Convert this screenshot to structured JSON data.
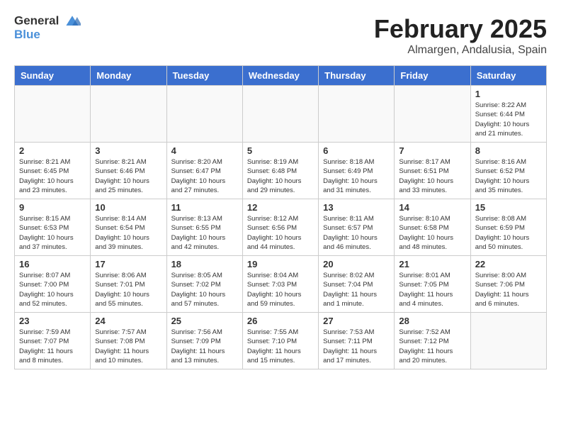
{
  "header": {
    "logo_line1": "General",
    "logo_line2": "Blue",
    "title": "February 2025",
    "subtitle": "Almargen, Andalusia, Spain"
  },
  "weekdays": [
    "Sunday",
    "Monday",
    "Tuesday",
    "Wednesday",
    "Thursday",
    "Friday",
    "Saturday"
  ],
  "weeks": [
    [
      {
        "day": "",
        "info": ""
      },
      {
        "day": "",
        "info": ""
      },
      {
        "day": "",
        "info": ""
      },
      {
        "day": "",
        "info": ""
      },
      {
        "day": "",
        "info": ""
      },
      {
        "day": "",
        "info": ""
      },
      {
        "day": "1",
        "info": "Sunrise: 8:22 AM\nSunset: 6:44 PM\nDaylight: 10 hours and 21 minutes."
      }
    ],
    [
      {
        "day": "2",
        "info": "Sunrise: 8:21 AM\nSunset: 6:45 PM\nDaylight: 10 hours and 23 minutes."
      },
      {
        "day": "3",
        "info": "Sunrise: 8:21 AM\nSunset: 6:46 PM\nDaylight: 10 hours and 25 minutes."
      },
      {
        "day": "4",
        "info": "Sunrise: 8:20 AM\nSunset: 6:47 PM\nDaylight: 10 hours and 27 minutes."
      },
      {
        "day": "5",
        "info": "Sunrise: 8:19 AM\nSunset: 6:48 PM\nDaylight: 10 hours and 29 minutes."
      },
      {
        "day": "6",
        "info": "Sunrise: 8:18 AM\nSunset: 6:49 PM\nDaylight: 10 hours and 31 minutes."
      },
      {
        "day": "7",
        "info": "Sunrise: 8:17 AM\nSunset: 6:51 PM\nDaylight: 10 hours and 33 minutes."
      },
      {
        "day": "8",
        "info": "Sunrise: 8:16 AM\nSunset: 6:52 PM\nDaylight: 10 hours and 35 minutes."
      }
    ],
    [
      {
        "day": "9",
        "info": "Sunrise: 8:15 AM\nSunset: 6:53 PM\nDaylight: 10 hours and 37 minutes."
      },
      {
        "day": "10",
        "info": "Sunrise: 8:14 AM\nSunset: 6:54 PM\nDaylight: 10 hours and 39 minutes."
      },
      {
        "day": "11",
        "info": "Sunrise: 8:13 AM\nSunset: 6:55 PM\nDaylight: 10 hours and 42 minutes."
      },
      {
        "day": "12",
        "info": "Sunrise: 8:12 AM\nSunset: 6:56 PM\nDaylight: 10 hours and 44 minutes."
      },
      {
        "day": "13",
        "info": "Sunrise: 8:11 AM\nSunset: 6:57 PM\nDaylight: 10 hours and 46 minutes."
      },
      {
        "day": "14",
        "info": "Sunrise: 8:10 AM\nSunset: 6:58 PM\nDaylight: 10 hours and 48 minutes."
      },
      {
        "day": "15",
        "info": "Sunrise: 8:08 AM\nSunset: 6:59 PM\nDaylight: 10 hours and 50 minutes."
      }
    ],
    [
      {
        "day": "16",
        "info": "Sunrise: 8:07 AM\nSunset: 7:00 PM\nDaylight: 10 hours and 52 minutes."
      },
      {
        "day": "17",
        "info": "Sunrise: 8:06 AM\nSunset: 7:01 PM\nDaylight: 10 hours and 55 minutes."
      },
      {
        "day": "18",
        "info": "Sunrise: 8:05 AM\nSunset: 7:02 PM\nDaylight: 10 hours and 57 minutes."
      },
      {
        "day": "19",
        "info": "Sunrise: 8:04 AM\nSunset: 7:03 PM\nDaylight: 10 hours and 59 minutes."
      },
      {
        "day": "20",
        "info": "Sunrise: 8:02 AM\nSunset: 7:04 PM\nDaylight: 11 hours and 1 minute."
      },
      {
        "day": "21",
        "info": "Sunrise: 8:01 AM\nSunset: 7:05 PM\nDaylight: 11 hours and 4 minutes."
      },
      {
        "day": "22",
        "info": "Sunrise: 8:00 AM\nSunset: 7:06 PM\nDaylight: 11 hours and 6 minutes."
      }
    ],
    [
      {
        "day": "23",
        "info": "Sunrise: 7:59 AM\nSunset: 7:07 PM\nDaylight: 11 hours and 8 minutes."
      },
      {
        "day": "24",
        "info": "Sunrise: 7:57 AM\nSunset: 7:08 PM\nDaylight: 11 hours and 10 minutes."
      },
      {
        "day": "25",
        "info": "Sunrise: 7:56 AM\nSunset: 7:09 PM\nDaylight: 11 hours and 13 minutes."
      },
      {
        "day": "26",
        "info": "Sunrise: 7:55 AM\nSunset: 7:10 PM\nDaylight: 11 hours and 15 minutes."
      },
      {
        "day": "27",
        "info": "Sunrise: 7:53 AM\nSunset: 7:11 PM\nDaylight: 11 hours and 17 minutes."
      },
      {
        "day": "28",
        "info": "Sunrise: 7:52 AM\nSunset: 7:12 PM\nDaylight: 11 hours and 20 minutes."
      },
      {
        "day": "",
        "info": ""
      }
    ]
  ]
}
